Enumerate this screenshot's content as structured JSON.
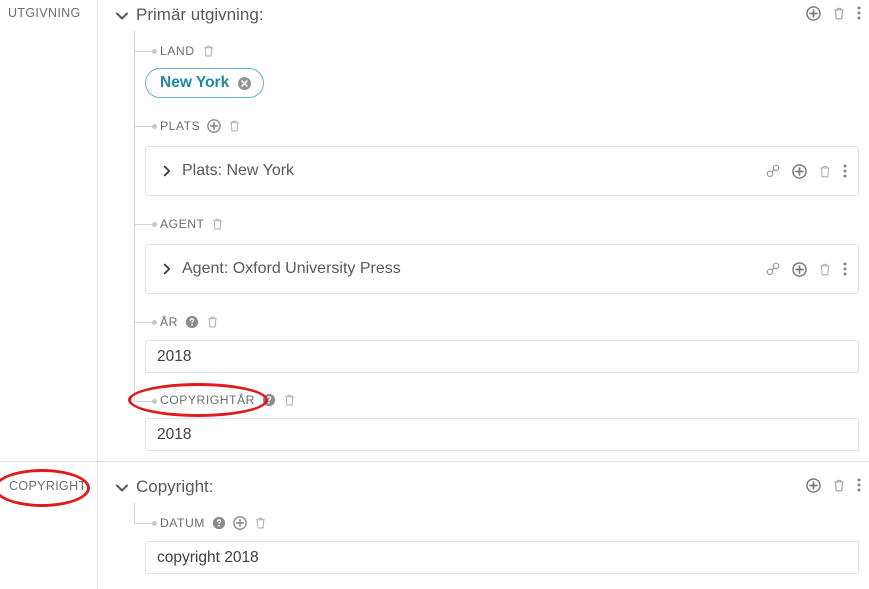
{
  "gutter": {
    "labels": [
      {
        "text": "UTGIVNING",
        "name": "gutter-label-utgivning"
      },
      {
        "text": "COPYRIGHT",
        "name": "gutter-label-copyright"
      }
    ]
  },
  "sections": {
    "utgivning": {
      "title": "Primär utgivning:",
      "chevron_icon": "chevron-down-icon",
      "actions": [
        "plus-circle-icon",
        "trash-icon",
        "kebab-menu-icon"
      ],
      "fields": {
        "land": {
          "label": "LAND",
          "icons": [
            "trash-icon"
          ],
          "chip": {
            "label": "New York",
            "remove_icon": "circle-x-icon"
          }
        },
        "plats": {
          "label": "PLATS",
          "icons": [
            "plus-circle-icon",
            "trash-icon"
          ],
          "card": {
            "title": "Plats: New York",
            "chevron_icon": "chevron-right-icon",
            "actions": [
              "link-icon",
              "plus-circle-icon",
              "trash-icon",
              "kebab-menu-icon"
            ]
          }
        },
        "agent": {
          "label": "AGENT",
          "icons": [
            "trash-icon"
          ],
          "card": {
            "title": "Agent: Oxford University Press",
            "chevron_icon": "chevron-right-icon",
            "actions": [
              "link-icon",
              "plus-circle-icon",
              "trash-icon",
              "kebab-menu-icon"
            ]
          }
        },
        "ar": {
          "label": "ÅR",
          "icons": [
            "help-circle-icon",
            "trash-icon"
          ],
          "value": "2018"
        },
        "copyrightar": {
          "label": "COPYRIGHTÅR",
          "icons": [
            "help-circle-icon",
            "trash-icon"
          ],
          "value": "2018"
        }
      }
    },
    "copyright": {
      "title": "Copyright:",
      "chevron_icon": "chevron-down-icon",
      "actions": [
        "plus-circle-icon",
        "trash-icon",
        "kebab-menu-icon"
      ],
      "fields": {
        "datum": {
          "label": "DATUM",
          "icons": [
            "help-circle-icon",
            "plus-circle-icon",
            "trash-icon"
          ],
          "value": "copyright 2018"
        }
      }
    }
  },
  "annotations": {
    "color": "#e01b1b",
    "ellipses": [
      {
        "target": "copyrightar-label"
      },
      {
        "target": "gutter-label-copyright"
      }
    ]
  },
  "colors": {
    "chip_border": "#5fb6c4",
    "chip_text": "#1d8a9b",
    "text": "#58595b",
    "label": "#6d6e71",
    "border": "#e1e2e3",
    "annotation": "#e01b1b"
  }
}
